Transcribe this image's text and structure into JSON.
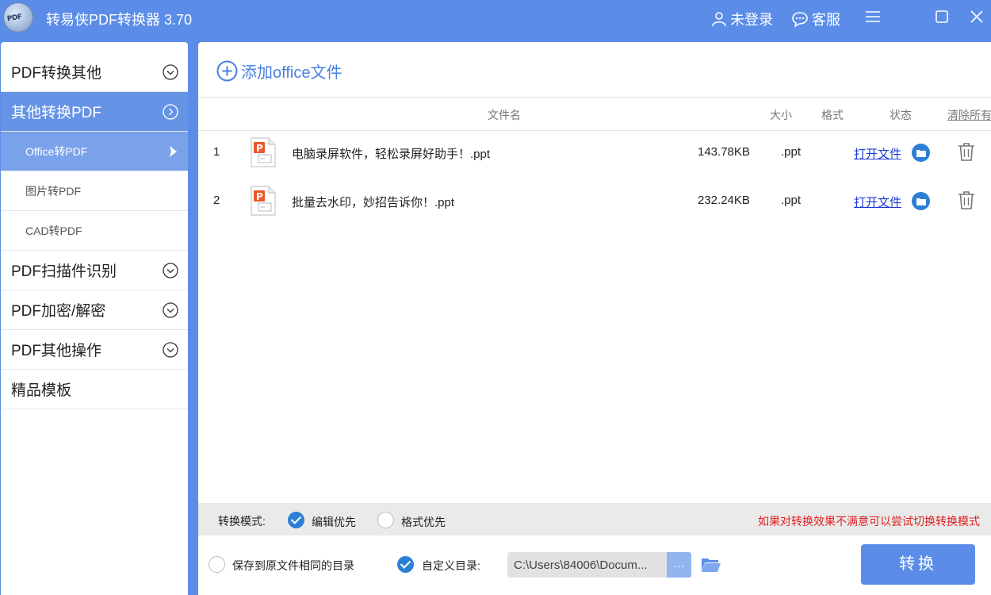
{
  "window": {
    "title": "转易侠PDF转换器 3.70",
    "logo_text": "PDF",
    "user_label": "未登录",
    "support_label": "客服"
  },
  "sidebar": {
    "items": [
      {
        "label": "PDF转换其他",
        "level": "main",
        "state": "collapsed"
      },
      {
        "label": "其他转换PDF",
        "level": "main",
        "state": "expanded",
        "active": true
      },
      {
        "label": "Office转PDF",
        "level": "sub",
        "active": true
      },
      {
        "label": "图片转PDF",
        "level": "sub"
      },
      {
        "label": "CAD转PDF",
        "level": "sub"
      },
      {
        "label": "PDF扫描件识别",
        "level": "main",
        "state": "collapsed"
      },
      {
        "label": "PDF加密/解密",
        "level": "main",
        "state": "collapsed"
      },
      {
        "label": "PDF其他操作",
        "level": "main",
        "state": "collapsed"
      },
      {
        "label": "精品模板",
        "level": "main"
      }
    ]
  },
  "main": {
    "add_label": "添加office文件",
    "columns": {
      "filename": "文件名",
      "size": "大小",
      "format": "格式",
      "status": "状态",
      "clear_all": "清除所有"
    },
    "files": [
      {
        "index": "1",
        "name": "电脑录屏软件，轻松录屏好助手！.ppt",
        "size": "143.78KB",
        "format": ".ppt",
        "action": "打开文件"
      },
      {
        "index": "2",
        "name": "批量去水印，妙招告诉你！.ppt",
        "size": "232.24KB",
        "format": ".ppt",
        "action": "打开文件"
      }
    ],
    "mode": {
      "label": "转换模式:",
      "options": [
        {
          "label": "编辑优先",
          "selected": true
        },
        {
          "label": "格式优先",
          "selected": false
        }
      ],
      "hint": "如果对转换效果不满意可以尝试切换转换模式"
    },
    "output": {
      "same_dir_label": "保存到原文件相同的目录",
      "same_dir_selected": false,
      "custom_dir_label": "自定义目录:",
      "custom_dir_selected": true,
      "path_value": "C:\\Users\\84006\\Docum...",
      "browse_label": "...",
      "convert_label": "转换"
    }
  },
  "colors": {
    "accent": "#5b8de8",
    "sidebar_active": "#6693e6",
    "checkbox_blue": "#2d7fd6",
    "hint_red": "#e02020",
    "link_blue": "#1a3ad6"
  }
}
